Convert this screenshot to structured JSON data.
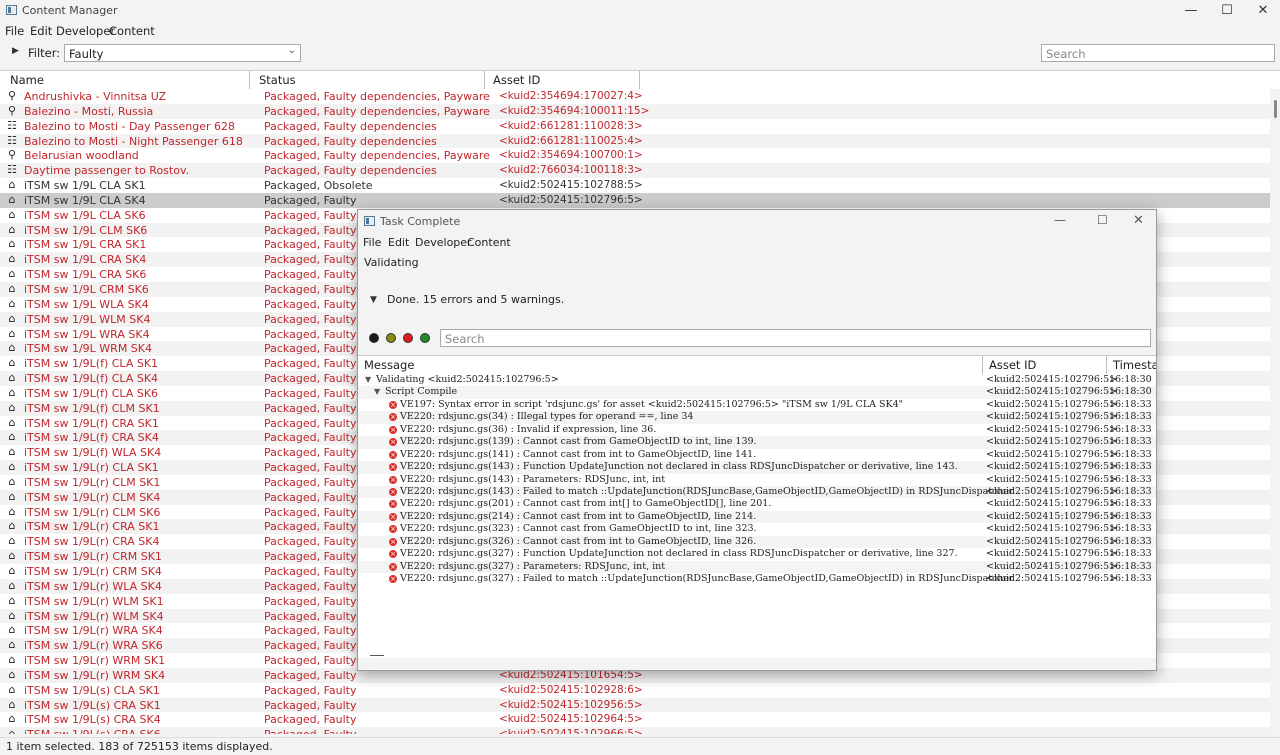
{
  "window": {
    "title": "Content Manager",
    "controls": {
      "minimize": "—",
      "maximize": "☐",
      "close": "✕"
    }
  },
  "menu": [
    "File",
    "Edit",
    "Developer",
    "Content"
  ],
  "filter": {
    "label": "Filter:",
    "value": "Faulty",
    "search_placeholder": "Search"
  },
  "columns": {
    "name": "Name",
    "status": "Status",
    "asset_id": "Asset ID"
  },
  "rows": [
    {
      "icon": "map-pin",
      "name": "Andrushivka - Vinnitsa UZ",
      "status": "Packaged, Faulty dependencies, Payware",
      "id": "<kuid2:354694:170027:4>",
      "faulty": true
    },
    {
      "icon": "map-pin",
      "name": "Balezino - Mosti, Russia",
      "status": "Packaged, Faulty dependencies, Payware",
      "id": "<kuid2:354694:100011:15>",
      "faulty": true
    },
    {
      "icon": "session",
      "name": "Balezino to Mosti - Day Passenger 628",
      "status": "Packaged, Faulty dependencies",
      "id": "<kuid2:661281:110028:3>",
      "faulty": true
    },
    {
      "icon": "session",
      "name": "Balezino to Mosti - Night Passenger 618",
      "status": "Packaged, Faulty dependencies",
      "id": "<kuid2:661281:110025:4>",
      "faulty": true
    },
    {
      "icon": "map-pin",
      "name": "Belarusian woodland",
      "status": "Packaged, Faulty dependencies, Payware",
      "id": "<kuid2:354694:100700:1>",
      "faulty": true
    },
    {
      "icon": "session",
      "name": "Daytime passenger to Rostov.",
      "status": "Packaged, Faulty dependencies",
      "id": "<kuid2:766034:100118:3>",
      "faulty": true
    },
    {
      "icon": "house",
      "name": "iTSM sw 1/9L CLA SK1",
      "status": "Packaged, Obsolete",
      "id": "<kuid2:502415:102788:5>",
      "faulty": false
    },
    {
      "icon": "house",
      "name": "iTSM sw 1/9L CLA SK4",
      "status": "Packaged, Faulty",
      "id": "<kuid2:502415:102796:5>",
      "faulty": false,
      "selected": true
    },
    {
      "icon": "house",
      "name": "iTSM sw 1/9L CLA SK6",
      "status": "Packaged, Faulty",
      "id": "",
      "faulty": true
    },
    {
      "icon": "house",
      "name": "iTSM sw 1/9L CLM SK6",
      "status": "Packaged, Faulty",
      "id": "",
      "faulty": true
    },
    {
      "icon": "house",
      "name": "iTSM sw 1/9L CRA SK1",
      "status": "Packaged, Faulty",
      "id": "",
      "faulty": true
    },
    {
      "icon": "house",
      "name": "iTSM sw 1/9L CRA SK4",
      "status": "Packaged, Faulty",
      "id": "",
      "faulty": true
    },
    {
      "icon": "house",
      "name": "iTSM sw 1/9L CRA SK6",
      "status": "Packaged, Faulty",
      "id": "",
      "faulty": true
    },
    {
      "icon": "house",
      "name": "iTSM sw 1/9L CRM SK6",
      "status": "Packaged, Faulty",
      "id": "",
      "faulty": true
    },
    {
      "icon": "house",
      "name": "iTSM sw 1/9L WLA SK4",
      "status": "Packaged, Faulty",
      "id": "",
      "faulty": true
    },
    {
      "icon": "house",
      "name": "iTSM sw 1/9L WLM SK4",
      "status": "Packaged, Faulty",
      "id": "",
      "faulty": true
    },
    {
      "icon": "house",
      "name": "iTSM sw 1/9L WRA SK4",
      "status": "Packaged, Faulty",
      "id": "",
      "faulty": true
    },
    {
      "icon": "house",
      "name": "iTSM sw 1/9L WRM SK4",
      "status": "Packaged, Faulty",
      "id": "",
      "faulty": true
    },
    {
      "icon": "house",
      "name": "iTSM sw 1/9L(f) CLA SK1",
      "status": "Packaged, Faulty",
      "id": "",
      "faulty": true
    },
    {
      "icon": "house",
      "name": "iTSM sw 1/9L(f) CLA SK4",
      "status": "Packaged, Faulty",
      "id": "",
      "faulty": true
    },
    {
      "icon": "house",
      "name": "iTSM sw 1/9L(f) CLA SK6",
      "status": "Packaged, Faulty",
      "id": "",
      "faulty": true
    },
    {
      "icon": "house",
      "name": "iTSM sw 1/9L(f) CLM SK1",
      "status": "Packaged, Faulty",
      "id": "",
      "faulty": true
    },
    {
      "icon": "house",
      "name": "iTSM sw 1/9L(f) CRA SK1",
      "status": "Packaged, Faulty",
      "id": "",
      "faulty": true
    },
    {
      "icon": "house",
      "name": "iTSM sw 1/9L(f) CRA SK4",
      "status": "Packaged, Faulty",
      "id": "",
      "faulty": true
    },
    {
      "icon": "house",
      "name": "iTSM sw 1/9L(f) WLA SK4",
      "status": "Packaged, Faulty",
      "id": "",
      "faulty": true
    },
    {
      "icon": "house",
      "name": "iTSM sw 1/9L(r) CLA SK1",
      "status": "Packaged, Faulty",
      "id": "",
      "faulty": true
    },
    {
      "icon": "house",
      "name": "iTSM sw 1/9L(r) CLM SK1",
      "status": "Packaged, Faulty",
      "id": "",
      "faulty": true
    },
    {
      "icon": "house",
      "name": "iTSM sw 1/9L(r) CLM SK4",
      "status": "Packaged, Faulty",
      "id": "",
      "faulty": true
    },
    {
      "icon": "house",
      "name": "iTSM sw 1/9L(r) CLM SK6",
      "status": "Packaged, Faulty",
      "id": "",
      "faulty": true
    },
    {
      "icon": "house",
      "name": "iTSM sw 1/9L(r) CRA SK1",
      "status": "Packaged, Faulty",
      "id": "",
      "faulty": true
    },
    {
      "icon": "house",
      "name": "iTSM sw 1/9L(r) CRA SK4",
      "status": "Packaged, Faulty",
      "id": "",
      "faulty": true
    },
    {
      "icon": "house",
      "name": "iTSM sw 1/9L(r) CRM SK1",
      "status": "Packaged, Faulty",
      "id": "",
      "faulty": true
    },
    {
      "icon": "house",
      "name": "iTSM sw 1/9L(r) CRM SK4",
      "status": "Packaged, Faulty",
      "id": "",
      "faulty": true
    },
    {
      "icon": "house",
      "name": "iTSM sw 1/9L(r) WLA SK4",
      "status": "Packaged, Faulty",
      "id": "",
      "faulty": true
    },
    {
      "icon": "house",
      "name": "iTSM sw 1/9L(r) WLM SK1",
      "status": "Packaged, Faulty",
      "id": "",
      "faulty": true
    },
    {
      "icon": "house",
      "name": "iTSM sw 1/9L(r) WLM SK4",
      "status": "Packaged, Faulty",
      "id": "",
      "faulty": true
    },
    {
      "icon": "house",
      "name": "iTSM sw 1/9L(r) WRA SK4",
      "status": "Packaged, Faulty",
      "id": "",
      "faulty": true
    },
    {
      "icon": "house",
      "name": "iTSM sw 1/9L(r) WRA SK6",
      "status": "Packaged, Faulty",
      "id": "",
      "faulty": true
    },
    {
      "icon": "house",
      "name": "iTSM sw 1/9L(r) WRM SK1",
      "status": "Packaged, Faulty",
      "id": "",
      "faulty": true
    },
    {
      "icon": "house",
      "name": "iTSM sw 1/9L(r) WRM SK4",
      "status": "Packaged, Faulty",
      "id": "<kuid2:502415:101654:5>",
      "faulty": true
    },
    {
      "icon": "house",
      "name": "iTSM sw 1/9L(s) CLA SK1",
      "status": "Packaged, Faulty",
      "id": "<kuid2:502415:102928:6>",
      "faulty": true
    },
    {
      "icon": "house",
      "name": "iTSM sw 1/9L(s) CRA SK1",
      "status": "Packaged, Faulty",
      "id": "<kuid2:502415:102956:5>",
      "faulty": true
    },
    {
      "icon": "house",
      "name": "iTSM sw 1/9L(s) CRA SK4",
      "status": "Packaged, Faulty",
      "id": "<kuid2:502415:102964:5>",
      "faulty": true
    },
    {
      "icon": "house",
      "name": "iTSM sw 1/9L(s) CRA SK6",
      "status": "Packaged, Faulty",
      "id": "<kuid2:502415:102966:5>",
      "faulty": true
    }
  ],
  "statusbar": "1 item selected. 183 of 725153 items displayed.",
  "dialog": {
    "title": "Task Complete",
    "menu": [
      "File",
      "Edit",
      "Developer",
      "Content"
    ],
    "phase": "Validating",
    "summary": "Done. 15 errors and 5 warnings.",
    "search_placeholder": "Search",
    "lights": [
      "#1a1a1a",
      "#8a8a10",
      "#e01818",
      "#1f8a2a"
    ],
    "columns": {
      "message": "Message",
      "asset_id": "Asset ID",
      "timestamp": "Timestamp"
    },
    "messages": [
      {
        "level": 0,
        "type": "group",
        "text": "Validating <kuid2:502415:102796:5>",
        "id": "<kuid2:502415:102796:5>",
        "ts": "16:18:30"
      },
      {
        "level": 1,
        "type": "group",
        "text": "Script Compile",
        "id": "<kuid2:502415:102796:5>",
        "ts": "16:18:30"
      },
      {
        "level": 2,
        "type": "error",
        "text": "VE197: Syntax error in script 'rdsjunc.gs' for asset <kuid2:502415:102796:5> \"iTSM sw 1/9L CLA SK4\"",
        "id": "<kuid2:502415:102796:5>",
        "ts": "16:18:33"
      },
      {
        "level": 2,
        "type": "error",
        "text": "VE220: rdsjunc.gs(34) : Illegal types for operand ==, line 34",
        "id": "<kuid2:502415:102796:5>",
        "ts": "16:18:33"
      },
      {
        "level": 2,
        "type": "error",
        "text": "VE220: rdsjunc.gs(36) : Invalid if expression, line 36.",
        "id": "<kuid2:502415:102796:5>",
        "ts": "16:18:33"
      },
      {
        "level": 2,
        "type": "error",
        "text": "VE220: rdsjunc.gs(139) : Cannot cast from GameObjectID to int, line 139.",
        "id": "<kuid2:502415:102796:5>",
        "ts": "16:18:33"
      },
      {
        "level": 2,
        "type": "error",
        "text": "VE220: rdsjunc.gs(141) : Cannot cast from int to GameObjectID, line 141.",
        "id": "<kuid2:502415:102796:5>",
        "ts": "16:18:33"
      },
      {
        "level": 2,
        "type": "error",
        "text": "VE220: rdsjunc.gs(143) : Function UpdateJunction not declared in class RDSJuncDispatcher or derivative, line 143.",
        "id": "<kuid2:502415:102796:5>",
        "ts": "16:18:33"
      },
      {
        "level": 2,
        "type": "error",
        "text": "VE220: rdsjunc.gs(143) :   Parameters: RDSJunc, int, int",
        "id": "<kuid2:502415:102796:5>",
        "ts": "16:18:33"
      },
      {
        "level": 2,
        "type": "error",
        "text": "VE220: rdsjunc.gs(143) :   Failed to match ::UpdateJunction(RDSJuncBase,GameObjectID,GameObjectID) in RDSJuncDispatcher",
        "id": "<kuid2:502415:102796:5>",
        "ts": "16:18:33"
      },
      {
        "level": 2,
        "type": "error",
        "text": "VE220: rdsjunc.gs(201) : Cannot cast from int[] to GameObjectID[], line 201.",
        "id": "<kuid2:502415:102796:5>",
        "ts": "16:18:33"
      },
      {
        "level": 2,
        "type": "error",
        "text": "VE220: rdsjunc.gs(214) : Cannot cast from int to GameObjectID, line 214.",
        "id": "<kuid2:502415:102796:5>",
        "ts": "16:18:33"
      },
      {
        "level": 2,
        "type": "error",
        "text": "VE220: rdsjunc.gs(323) : Cannot cast from GameObjectID to int, line 323.",
        "id": "<kuid2:502415:102796:5>",
        "ts": "16:18:33"
      },
      {
        "level": 2,
        "type": "error",
        "text": "VE220: rdsjunc.gs(326) : Cannot cast from int to GameObjectID, line 326.",
        "id": "<kuid2:502415:102796:5>",
        "ts": "16:18:33"
      },
      {
        "level": 2,
        "type": "error",
        "text": "VE220: rdsjunc.gs(327) : Function UpdateJunction not declared in class RDSJuncDispatcher or derivative, line 327.",
        "id": "<kuid2:502415:102796:5>",
        "ts": "16:18:33"
      },
      {
        "level": 2,
        "type": "error",
        "text": "VE220: rdsjunc.gs(327) :   Parameters: RDSJunc, int, int",
        "id": "<kuid2:502415:102796:5>",
        "ts": "16:18:33"
      },
      {
        "level": 2,
        "type": "error",
        "text": "VE220: rdsjunc.gs(327) :   Failed to match ::UpdateJunction(RDSJuncBase,GameObjectID,GameObjectID) in RDSJuncDispatcher",
        "id": "<kuid2:502415:102796:5>",
        "ts": "16:18:33"
      }
    ]
  }
}
